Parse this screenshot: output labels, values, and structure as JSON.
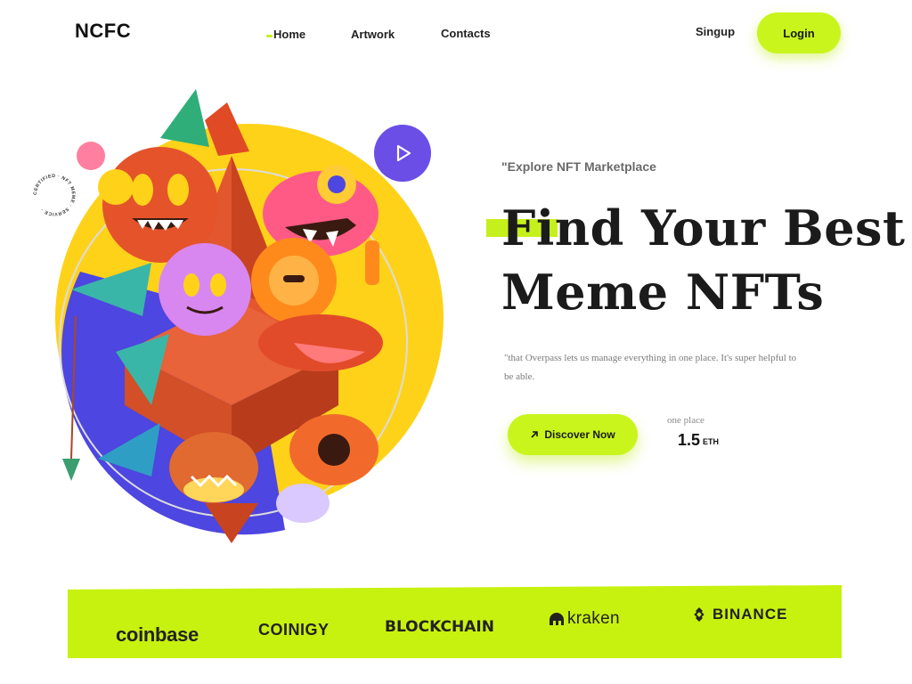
{
  "nav": {
    "logo": "NCFC",
    "links": [
      "Home",
      "Artwork",
      "Contacts"
    ],
    "active_link": "Home",
    "signup_label": "Singup",
    "login_label": "Login"
  },
  "hero": {
    "eyebrow": "\"Explore NFT Marketplace",
    "headline_line1": "Find Your Best",
    "headline_line2": "Meme NFTs",
    "quote": "\"that Overpass lets us manage everything in one place. It's super helpful to be able.",
    "cta_label": "Discover Now",
    "price_label": "one place",
    "price_value": "1.5",
    "price_unit": "ETH"
  },
  "badge": {
    "ring_text": "CERTIFIED · NFT MEME · SERVICE ·"
  },
  "partners": [
    "coinbase",
    "COINIGY",
    "BLOCKCHAIN",
    "kraken",
    "BINANCE"
  ],
  "colors": {
    "accent": "#c9f51c",
    "play_button": "#6b4ee6",
    "circle_yellow": "#ffd21a",
    "circle_blue": "#4d46e0",
    "text_dark": "#1b1b1b"
  },
  "icons": {
    "play": "play-icon",
    "discover": "arrow-up-right-icon",
    "kraken": "kraken-logo-icon",
    "binance": "binance-logo-icon",
    "coinigy": "coinigy-spark-icon"
  }
}
